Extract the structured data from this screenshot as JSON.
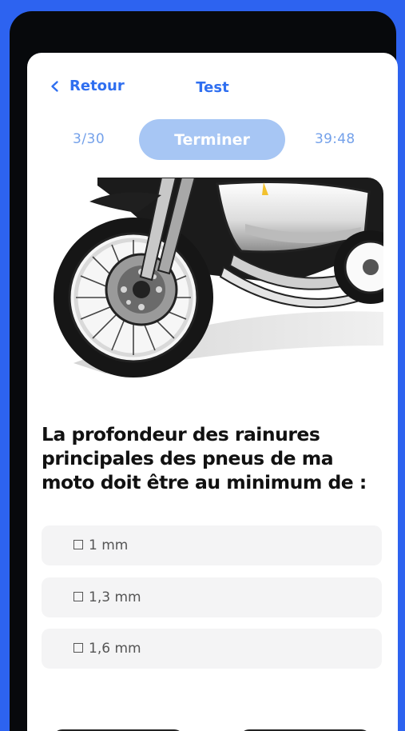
{
  "nav": {
    "back_label": "Retour",
    "title": "Test"
  },
  "quiz": {
    "progress": "3/30",
    "finish_label": "Terminer",
    "timer": "39:48",
    "question": "La profondeur des rainures principales des pneus de ma moto doit être au minimum de :",
    "answers": [
      {
        "label": "1 mm"
      },
      {
        "label": "1,3 mm"
      },
      {
        "label": "1,6 mm"
      }
    ]
  },
  "colors": {
    "accent": "#2f6ff0",
    "background": "#2d63f0"
  }
}
